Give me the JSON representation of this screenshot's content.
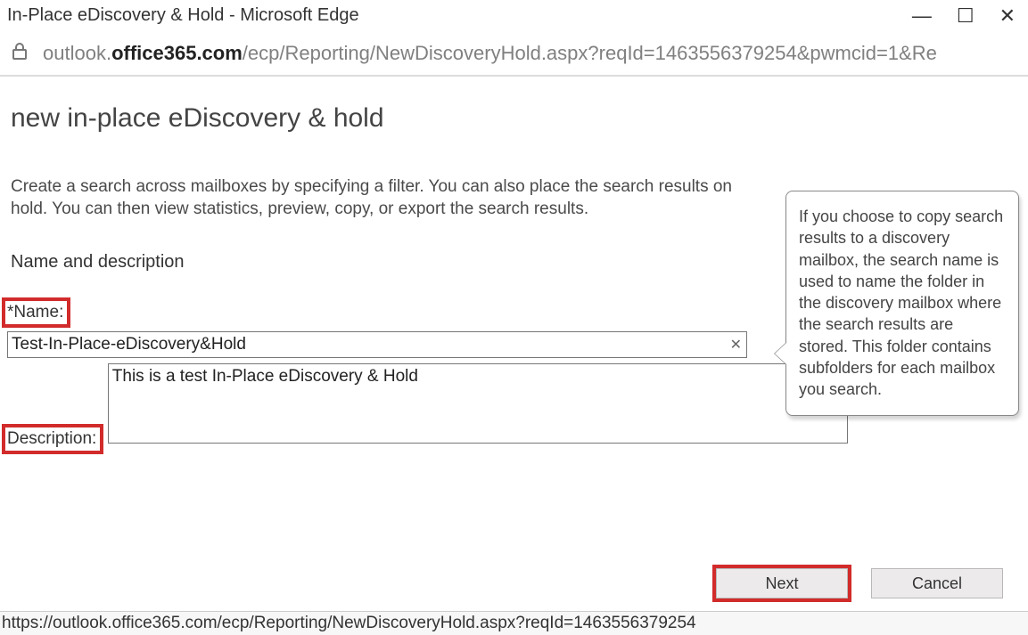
{
  "window": {
    "title": "In-Place eDiscovery & Hold - Microsoft Edge"
  },
  "address": {
    "url_prefix": "outlook.",
    "url_host_strong": "office365.com",
    "url_path": "/ecp/Reporting/NewDiscoveryHold.aspx?reqId=1463556379254&pwmcid=1&Re"
  },
  "page": {
    "heading": "new in-place eDiscovery & hold",
    "intro": "Create a search across mailboxes by specifying a filter. You can also place the search results on hold. You can then view statistics, preview, copy, or export the search results.",
    "section": "Name and description"
  },
  "fields": {
    "name_label": "*Name:",
    "name_value": "Test-In-Place-eDiscovery&Hold",
    "description_label": "Description:",
    "description_value": "This is a test In-Place eDiscovery & Hold"
  },
  "tooltip": {
    "text": "If you choose to copy search results to a discovery mailbox, the search name is used to name the folder in the discovery mailbox where the search results are stored. This folder contains subfolders for each mailbox you search."
  },
  "buttons": {
    "next": "Next",
    "cancel": "Cancel"
  },
  "statusbar": {
    "text": "https://outlook.office365.com/ecp/Reporting/NewDiscoveryHold.aspx?reqId=1463556379254"
  }
}
